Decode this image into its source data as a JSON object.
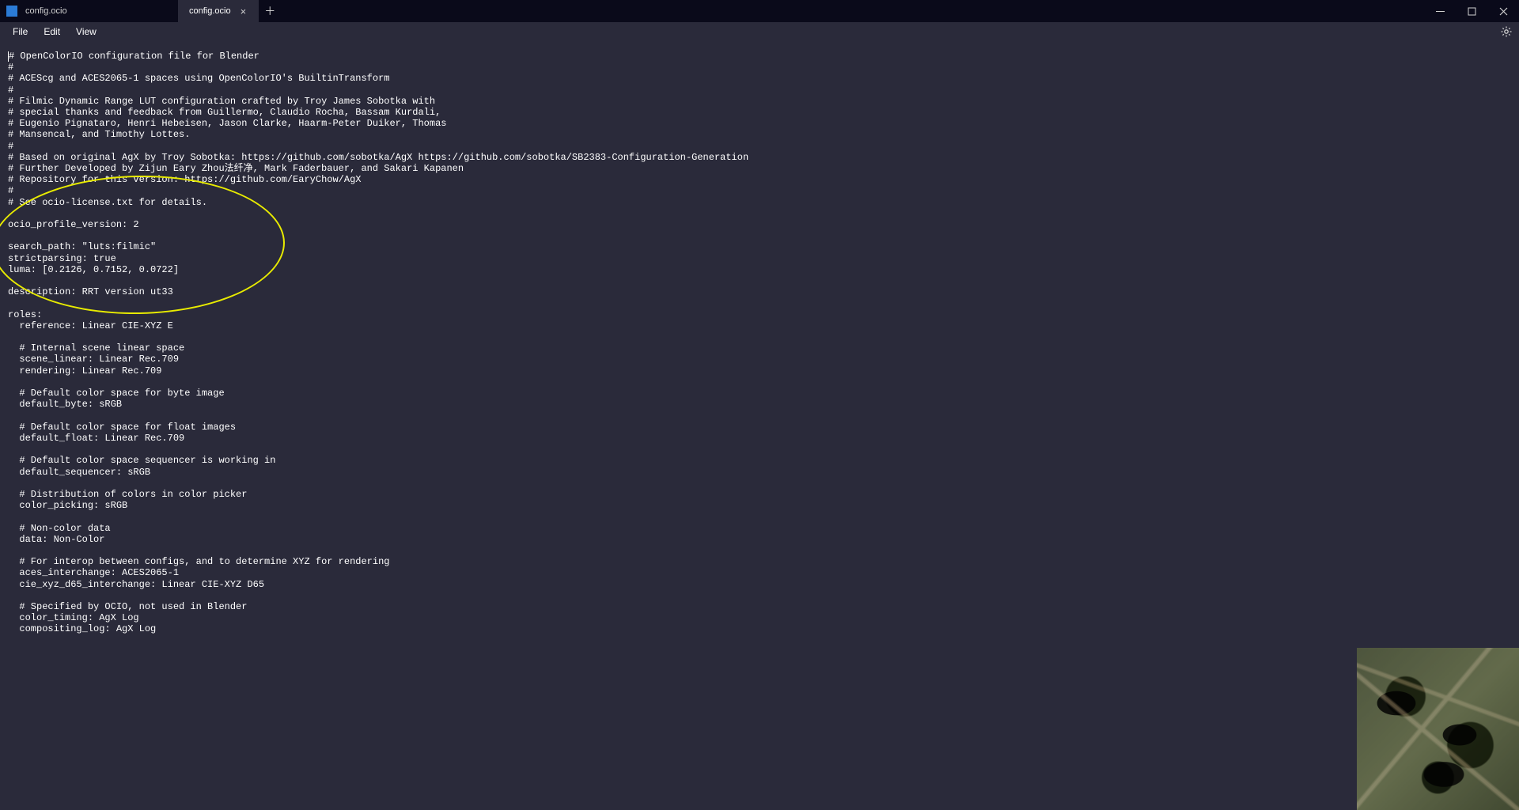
{
  "window": {
    "title": "config.ocio",
    "tab_label": "config.ocio"
  },
  "menu": {
    "file": "File",
    "edit": "Edit",
    "view": "View"
  },
  "editor": {
    "lines": [
      "# OpenColorIO configuration file for Blender",
      "#",
      "# ACEScg and ACES2065-1 spaces using OpenColorIO's BuiltinTransform",
      "#",
      "# Filmic Dynamic Range LUT configuration crafted by Troy James Sobotka with",
      "# special thanks and feedback from Guillermo, Claudio Rocha, Bassam Kurdali,",
      "# Eugenio Pignataro, Henri Hebeisen, Jason Clarke, Haarm-Peter Duiker, Thomas",
      "# Mansencal, and Timothy Lottes.",
      "#",
      "# Based on original AgX by Troy Sobotka: https://github.com/sobotka/AgX https://github.com/sobotka/SB2383-Configuration-Generation",
      "# Further Developed by Zijun Eary Zhou法纤净, Mark Faderbauer, and Sakari Kapanen",
      "# Repository for this version: https://github.com/EaryChow/AgX",
      "#",
      "# See ocio-license.txt for details.",
      "",
      "ocio_profile_version: 2",
      "",
      "search_path: \"luts:filmic\"",
      "strictparsing: true",
      "luma: [0.2126, 0.7152, 0.0722]",
      "",
      "description: RRT version ut33",
      "",
      "roles:",
      "  reference: Linear CIE-XYZ E",
      "",
      "  # Internal scene linear space",
      "  scene_linear: Linear Rec.709",
      "  rendering: Linear Rec.709",
      "",
      "  # Default color space for byte image",
      "  default_byte: sRGB",
      "",
      "  # Default color space for float images",
      "  default_float: Linear Rec.709",
      "",
      "  # Default color space sequencer is working in",
      "  default_sequencer: sRGB",
      "",
      "  # Distribution of colors in color picker",
      "  color_picking: sRGB",
      "",
      "  # Non-color data",
      "  data: Non-Color",
      "",
      "  # For interop between configs, and to determine XYZ for rendering",
      "  aces_interchange: ACES2065-1",
      "  cie_xyz_d65_interchange: Linear CIE-XYZ D65",
      "",
      "  # Specified by OCIO, not used in Blender",
      "  color_timing: AgX Log",
      "  compositing_log: AgX Log"
    ]
  }
}
